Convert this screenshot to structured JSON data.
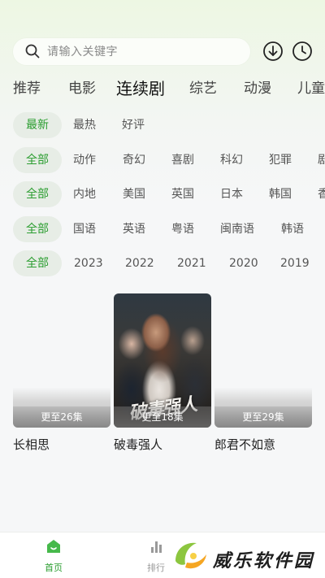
{
  "search": {
    "placeholder": "请输入关键字"
  },
  "header_icons": [
    "download-icon",
    "history-icon"
  ],
  "category_tabs": [
    "推荐",
    "电影",
    "连续剧",
    "综艺",
    "动漫",
    "儿童"
  ],
  "active_category": "连续剧",
  "filters": {
    "sort": [
      "最新",
      "最热",
      "好评"
    ],
    "genre": [
      "全部",
      "动作",
      "奇幻",
      "喜剧",
      "科幻",
      "犯罪",
      "剧"
    ],
    "region": [
      "全部",
      "内地",
      "美国",
      "英国",
      "日本",
      "韩国",
      "香"
    ],
    "language": [
      "全部",
      "国语",
      "英语",
      "粤语",
      "闽南语",
      "韩语"
    ],
    "year": [
      "全部",
      "2023",
      "2022",
      "2021",
      "2020",
      "2019"
    ]
  },
  "cards": [
    {
      "title": "长相思",
      "episodes": "更至26集"
    },
    {
      "title": "破毒强人",
      "episodes": "更至18集",
      "poster_title": "破毒强人"
    },
    {
      "title": "郎君不如意",
      "episodes": "更至29集"
    }
  ],
  "bottom_nav": [
    {
      "label": "首页",
      "icon": "home-icon"
    },
    {
      "label": "排行",
      "icon": "ranking-icon"
    }
  ],
  "watermark": {
    "text": "威乐软件园"
  },
  "colors": {
    "accent": "#2a9d2f",
    "chip_bg": "#e7ede6"
  }
}
